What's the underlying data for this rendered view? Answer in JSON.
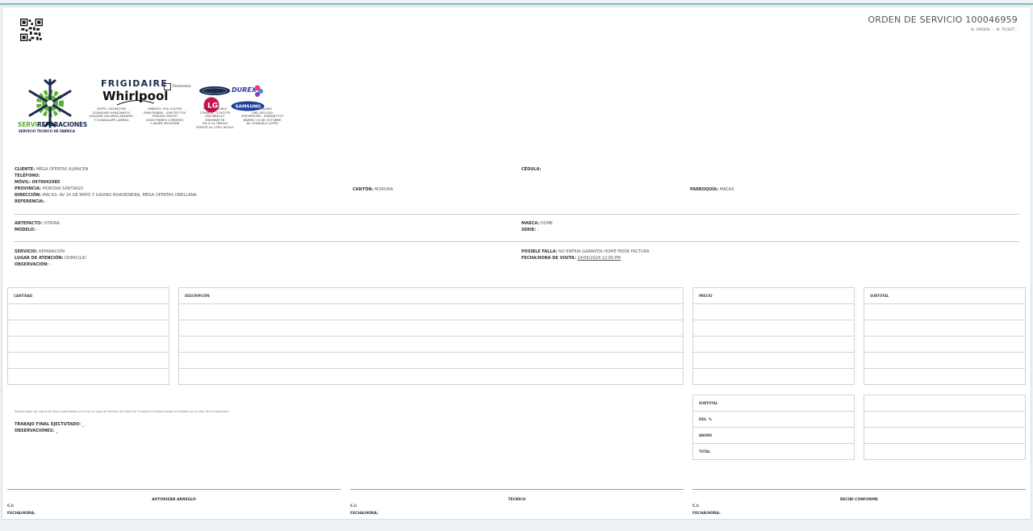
{
  "order": {
    "title": "ORDEN DE SERVICIO 100046959",
    "subtitle": "N. ORDEN: - - N. TICKET: -"
  },
  "company": {
    "name_part1": "SERVI",
    "name_part2": "REPARACIONES",
    "tagline": "SERVICIO TECNICO DE FABRICA",
    "brands": [
      "FRIGIDAIRE",
      "Whirlpool",
      "Electrolux",
      "INDURAMA",
      "DUREX",
      "LG",
      "SAMSUNG"
    ],
    "electrolux_sub": "Electrolux",
    "addresses": [
      {
        "lines": [
          "QUITO: 022992782",
          "0226/0465 0994296070",
          "JOAQUIN GALARZA ANVARIO",
          "Y GUADALUPE LARREA"
        ]
      },
      {
        "lines": [
          "AMBATO: (03) 414790",
          "0994764880 - 0997327730",
          "PURUHA OROZO",
          "LEON FEBRES CORDERO",
          "Y JAVIER ASCAZUBI"
        ]
      },
      {
        "lines": [
          "PUYO: 2792854",
          "2792871 - 2793733",
          "0997880127",
          "0990968778",
          "VIA A LA TARQUI",
          "FRENTE AL CTRO AFOLO"
        ]
      },
      {
        "lines": [
          "LAGO AGRIO",
          "(06) 2811292",
          "0997899789 - 0998267373",
          "BARRIO 14 DE OCTUBRE",
          "AV. GONZALO LOPEZ"
        ]
      }
    ],
    "colors": {
      "navy": "#1a2b4c",
      "green": "#5fae3a"
    }
  },
  "client": {
    "cliente_label": "CLIENTE:",
    "cliente_value": "MEGA OFERTAS ALMACEN",
    "telefono_label": "TELÉFONO:",
    "telefono_value": "",
    "movil_label": "MÓVIL:",
    "movil_value": "0979042085",
    "provincia_label": "PROVINCIA:",
    "provincia_value": "MORONA SANTIAGO",
    "direccion_label": "DIRECCIÓN:",
    "direccion_value": "MACAS- AV 24 DE MAYO Y GAVINO RIVADENEIRA, MEGA OFERTAS ORELLANA",
    "referencia_label": "REFERENCIA:",
    "referencia_value": "-",
    "cedula_label": "CÉDULA:",
    "cedula_value": "",
    "canton_label": "CANTÓN:",
    "canton_value": "MORONA",
    "parroquia_label": "PARROQUÍA:",
    "parroquia_value": "MACAS"
  },
  "device": {
    "artefacto_label": "ARTEFACTO:",
    "artefacto_value": "VITRINA",
    "modelo_label": "MODELO:",
    "modelo_value": "-",
    "marca_label": "MARCA:",
    "marca_value": "HOME",
    "serie_label": "SERIE:",
    "serie_value": "-"
  },
  "service": {
    "servicio_label": "SERVICIO:",
    "servicio_value": "REPARACIÓN",
    "lugar_label": "LUGAR DE ATENCIÓN:",
    "lugar_value": "DOMICILIO",
    "observacion_label": "OBSERVACIÓN:",
    "observacion_value": "-",
    "falla_label": "POSIBLE FALLA:",
    "falla_value": "NO ENFRIA GARANTIA HOME PEDIR FACTURA",
    "fecha_label": "FECHA/HORA DE VISITA:",
    "fecha_value": "24/06/2024 12:00 PM"
  },
  "table": {
    "headers": [
      "CANTIDAD",
      "DESCRIPCIÓN",
      "PRECIO",
      "SUBTOTAL"
    ],
    "blank_rows": 5
  },
  "totals": {
    "labels": [
      "SUBTOTAL",
      "DES. %",
      "ABONO",
      "TOTAL"
    ],
    "values": [
      "",
      "",
      "",
      ""
    ]
  },
  "notes": {
    "disclaimer": "Acepto pagar los rubros de mano autorizados por la ley en caso de retirarlo (sin retiro en 3 meses el trabajo acepto se tomado por el valor de la reparación).",
    "trabajo_label": "TRABAJO FINAL EJECTUTADO:",
    "trabajo_value": "_",
    "observaciones_label": "OBSERVACIONES:",
    "observaciones_value": "_"
  },
  "signatures": [
    {
      "title": "AUTORIZAR ARREGLO",
      "ci": "C.I:",
      "fecha": "FECHA/HORA:"
    },
    {
      "title": "TECNICO",
      "ci": "C.I:",
      "fecha": "FECHA/HORA:"
    },
    {
      "title": "RECIBI CONFORME",
      "ci": "C.I:",
      "fecha": "FECHA/HORA:"
    }
  ]
}
